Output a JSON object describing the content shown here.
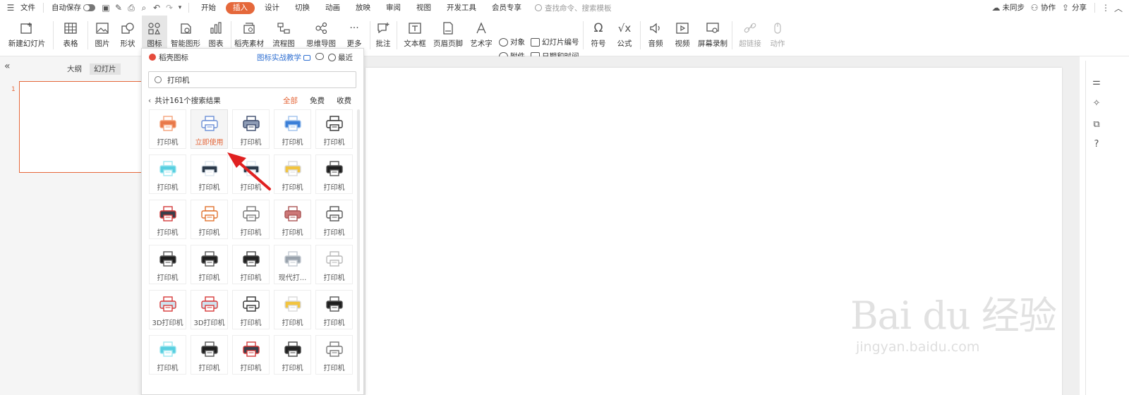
{
  "menubar": {
    "file_label": "文件",
    "autosave_label": "自动保存",
    "tabs": [
      "开始",
      "插入",
      "设计",
      "切换",
      "动画",
      "放映",
      "审阅",
      "视图",
      "开发工具",
      "会员专享"
    ],
    "search_placeholder": "查找命令、搜索模板",
    "sync_label": "未同步",
    "collab_label": "协作",
    "share_label": "分享"
  },
  "ribbon": {
    "new_slide": "新建幻灯片",
    "table": "表格",
    "image": "图片",
    "shape": "形状",
    "icon": "图标",
    "smart_shape": "智能图形",
    "chart": "图表",
    "material": "稻壳素材",
    "flowchart": "流程图",
    "mindmap": "思维导图",
    "more": "更多",
    "comment": "批注",
    "textbox": "文本框",
    "header_footer": "页眉页脚",
    "art_text": "艺术字",
    "object": "对象",
    "attachment": "附件",
    "slide_number": "幻灯片编号",
    "datetime": "日期和时间",
    "symbol": "符号",
    "formula": "公式",
    "audio": "音频",
    "video": "视频",
    "screen_record": "屏幕录制",
    "hyperlink": "超链接",
    "action": "动作"
  },
  "leftpane": {
    "outline_tab": "大纲",
    "slides_tab": "幻灯片",
    "slide_number": "1"
  },
  "panel": {
    "title": "稻壳图标",
    "tutorial_link": "图标实战教学",
    "recent_label": "最近",
    "search_value": "打印机",
    "result_count": "共计161个搜索结果",
    "filters": [
      "全部",
      "免费",
      "收费"
    ],
    "use_now": "立即使用",
    "items": [
      {
        "label": "打印机",
        "icon": "printer-orange-icon"
      },
      {
        "label": "打印机",
        "icon": "printer-outline-blue-icon"
      },
      {
        "label": "打印机",
        "icon": "printer-blue-gray-icon"
      },
      {
        "label": "打印机",
        "icon": "printer-blue-icon"
      },
      {
        "label": "打印机",
        "icon": "printer-line-icon"
      },
      {
        "label": "打印机",
        "icon": "printer-cyan-icon"
      },
      {
        "label": "打印机",
        "icon": "printer-3d-dark-icon"
      },
      {
        "label": "打印机",
        "icon": "printer-3d-dark-icon"
      },
      {
        "label": "打印机",
        "icon": "printer-yellow-icon"
      },
      {
        "label": "打印机",
        "icon": "printer-black-icon"
      },
      {
        "label": "打印机",
        "icon": "printer-red-dark-icon"
      },
      {
        "label": "打印机",
        "icon": "printer-orange-line-icon"
      },
      {
        "label": "打印机",
        "icon": "printer-paper-line-icon"
      },
      {
        "label": "打印机",
        "icon": "printer-red-line-icon"
      },
      {
        "label": "打印机",
        "icon": "printer-small-line-icon"
      },
      {
        "label": "打印机",
        "icon": "printer-black-icon"
      },
      {
        "label": "打印机",
        "icon": "printer-black-icon"
      },
      {
        "label": "打印机",
        "icon": "printer-solid-icon"
      },
      {
        "label": "现代打...",
        "icon": "printer-gray-icon"
      },
      {
        "label": "打印机",
        "icon": "printer-light-gray-icon"
      },
      {
        "label": "3D打印机",
        "icon": "printer-3d-red-icon"
      },
      {
        "label": "3D打印机",
        "icon": "printer-3d-red-icon"
      },
      {
        "label": "打印机",
        "icon": "printer-line-icon"
      },
      {
        "label": "打印机",
        "icon": "printer-yellow-icon"
      },
      {
        "label": "打印机",
        "icon": "printer-black-icon"
      },
      {
        "label": "打印机",
        "icon": "printer-cyan-icon"
      },
      {
        "label": "打印机",
        "icon": "printer-black-icon"
      },
      {
        "label": "打印机",
        "icon": "printer-red-dark-icon"
      },
      {
        "label": "打印机",
        "icon": "printer-solid-icon"
      },
      {
        "label": "打印机",
        "icon": "printer-paper-line-icon"
      }
    ]
  },
  "watermark": {
    "brand": "Bai du 经验",
    "url": "jingyan.baidu.com"
  },
  "colors": {
    "accent": "#e5683b",
    "link": "#2f6fd1"
  }
}
